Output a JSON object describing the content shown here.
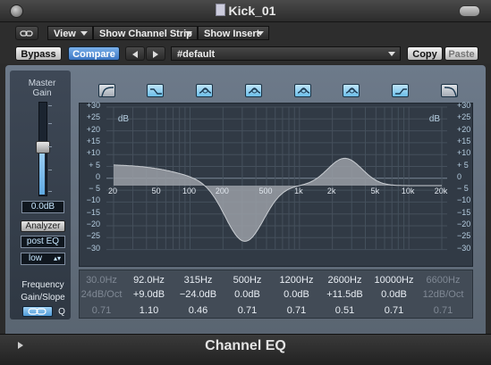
{
  "window": {
    "title": "Kick_01"
  },
  "toolbar": {
    "link_icon": "link-icon",
    "view_label": "View",
    "show_channel_strip_label": "Show Channel Strip",
    "show_insert_label": "Show Insert",
    "bypass_label": "Bypass",
    "compare_label": "Compare",
    "prev_icon": "arrow-left-icon",
    "next_icon": "arrow-right-icon",
    "preset_value": "#default",
    "copy_label": "Copy",
    "paste_label": "Paste"
  },
  "left_panel": {
    "master_gain_label": "Master\nGain",
    "master_gain_value": "0.0dB",
    "analyzer_label": "Analyzer",
    "post_eq_label": "post EQ",
    "resolution_value": "low"
  },
  "bands": [
    {
      "icon": "low-cut-icon",
      "active": false
    },
    {
      "icon": "low-shelf-icon",
      "active": true
    },
    {
      "icon": "bell-icon",
      "active": true
    },
    {
      "icon": "bell-icon",
      "active": true
    },
    {
      "icon": "bell-icon",
      "active": true
    },
    {
      "icon": "bell-icon",
      "active": true
    },
    {
      "icon": "high-shelf-icon",
      "active": true
    },
    {
      "icon": "high-cut-icon",
      "active": false
    }
  ],
  "graph": {
    "db_unit": "dB",
    "db_scale": [
      "+30",
      "+25",
      "+20",
      "+15",
      "+10",
      "+ 5",
      "0",
      "− 5",
      "−10",
      "−15",
      "−20",
      "−25",
      "−30"
    ],
    "freq_labels": [
      "20",
      "50",
      "100",
      "200",
      "500",
      "1k",
      "2k",
      "5k",
      "10k",
      "20k"
    ]
  },
  "params": {
    "row_labels": {
      "frequency": "Frequency",
      "gain_slope": "Gain/Slope",
      "q": "Q",
      "link_icon": "link-icon"
    },
    "frequency": [
      "30.0Hz",
      "92.0Hz",
      "315Hz",
      "500Hz",
      "1200Hz",
      "2600Hz",
      "10000Hz",
      "6600Hz"
    ],
    "gain": [
      "24dB/Oct",
      "+9.0dB",
      "−24.0dB",
      "0.0dB",
      "0.0dB",
      "+11.5dB",
      "0.0dB",
      "12dB/Oct"
    ],
    "q": [
      "0.71",
      "1.10",
      "0.46",
      "0.71",
      "0.71",
      "0.51",
      "0.71",
      "0.71"
    ]
  },
  "footer": {
    "plugin_name": "Channel EQ"
  },
  "colors": {
    "accent": "#5fa9e2",
    "curve_fill": "#9a9fa6",
    "panel": "#5e6a77"
  }
}
